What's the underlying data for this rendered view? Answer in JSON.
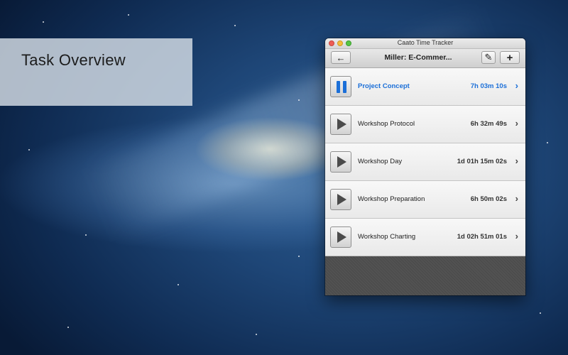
{
  "overlay": {
    "title": "Task Overview"
  },
  "window": {
    "title": "Caato Time Tracker"
  },
  "toolbar": {
    "back_icon": "←",
    "project_title": "Miller: E-Commer...",
    "edit_icon": "✎",
    "add_icon": "+"
  },
  "tasks": [
    {
      "name": "Project Concept",
      "time": "7h 03m 10s",
      "state": "running"
    },
    {
      "name": "Workshop Protocol",
      "time": "6h 32m 49s",
      "state": "stopped"
    },
    {
      "name": "Workshop Day",
      "time": "1d 01h 15m 02s",
      "state": "stopped"
    },
    {
      "name": "Workshop Preparation",
      "time": "6h 50m 02s",
      "state": "stopped"
    },
    {
      "name": "Workshop Charting",
      "time": "1d 02h 51m 01s",
      "state": "stopped"
    }
  ],
  "icons": {
    "chevron": "›",
    "play": "play-icon",
    "pause": "pause-icon"
  },
  "colors": {
    "accent": "#1b6fd8",
    "text": "#222222",
    "linen": "#4a4a4a"
  }
}
